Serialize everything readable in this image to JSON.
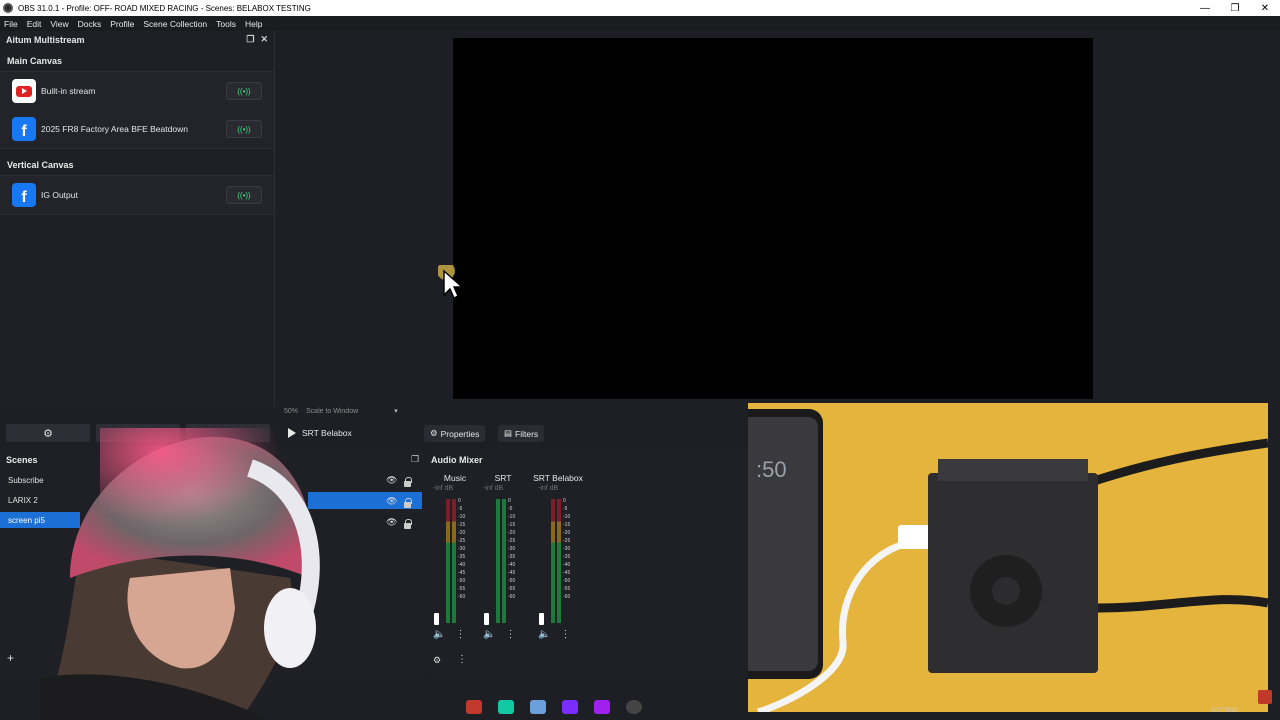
{
  "window": {
    "title": "OBS 31.0.1 - Profile: OFF- ROAD MIXED RACING - Scenes: BELABOX TESTING",
    "minimize": "—",
    "maximize": "❐",
    "close": "✕"
  },
  "menu": [
    "File",
    "Edit",
    "View",
    "Docks",
    "Profile",
    "Scene Collection",
    "Tools",
    "Help"
  ],
  "multistream": {
    "title": "Aitum Multistream",
    "main_canvas_label": "Main Canvas",
    "main_outputs": [
      {
        "service": "youtube-icon",
        "label": "Built-in stream"
      },
      {
        "service": "facebook-icon",
        "label": "2025 FR8 Factory Area BFE Beatdown"
      }
    ],
    "vertical_canvas_label": "Vertical Canvas",
    "vertical_outputs": [
      {
        "service": "facebook-icon",
        "label": "IG Output"
      }
    ],
    "toggle_symbol": "((•))"
  },
  "preview": {
    "zoom": "50%",
    "scale_mode": "Scale to Window"
  },
  "source_toolbar": {
    "source_name": "SRT Belabox",
    "properties": "Properties",
    "filters": "Filters"
  },
  "scenes": {
    "title": "Scenes",
    "items": [
      "Subscribe",
      "LARIX 2",
      "screen pi5"
    ],
    "selected": "screen pi5",
    "add": "+"
  },
  "mixer": {
    "title": "Audio Mixer",
    "channels": [
      {
        "name": "Music",
        "db": "-inf dB"
      },
      {
        "name": "SRT",
        "db": "-inf dB"
      },
      {
        "name": "SRT Belabox",
        "db": "-inf dB"
      }
    ],
    "scale": [
      "0",
      "-5",
      "-10",
      "-15",
      "-20",
      "-25",
      "-30",
      "-35",
      "-40",
      "-45",
      "-50",
      "-55",
      "-60"
    ]
  },
  "video_overlay": {
    "phone_time": ":50"
  },
  "taskbar": {
    "date": "5/27/2025"
  }
}
